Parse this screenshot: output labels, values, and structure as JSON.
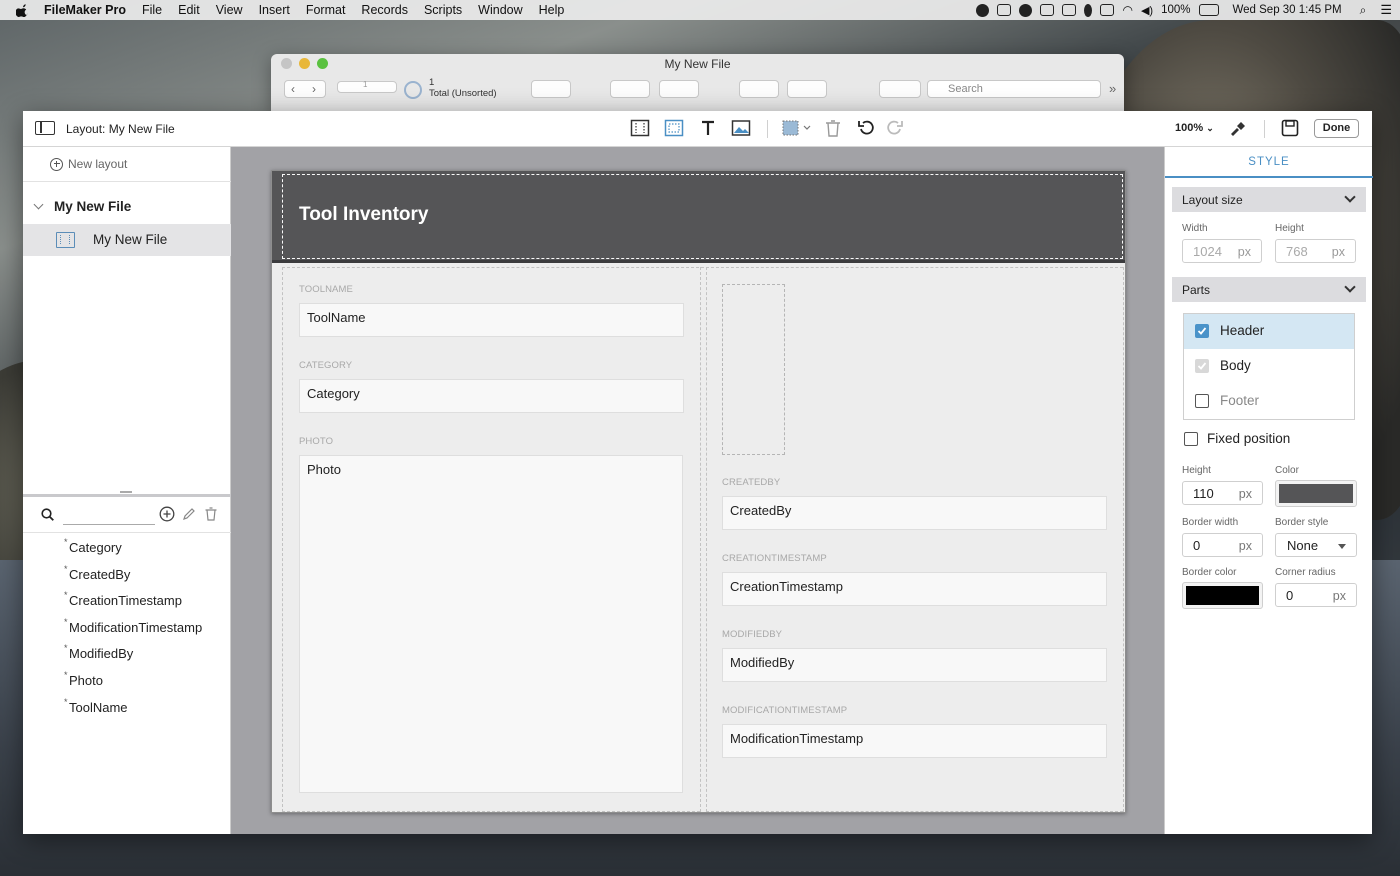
{
  "menubar": {
    "app_name": "FileMaker Pro",
    "menus": [
      "File",
      "Edit",
      "View",
      "Insert",
      "Format",
      "Records",
      "Scripts",
      "Window",
      "Help"
    ],
    "battery": "100%",
    "datetime": "Wed Sep 30  1:45 PM"
  },
  "browse_window": {
    "title": "My New File",
    "record_number": "1",
    "record_count": "1",
    "total_label": "Total (Unsorted)",
    "search_placeholder": "Search"
  },
  "layout_window": {
    "title": "Layout: My New File",
    "zoom": "100%",
    "done_label": "Done"
  },
  "left_panel": {
    "new_layout_label": "New layout",
    "folder_name": "My New File",
    "layout_name": "My New File",
    "fields": [
      "Category",
      "CreatedBy",
      "CreationTimestamp",
      "ModificationTimestamp",
      "ModifiedBy",
      "Photo",
      "ToolName"
    ]
  },
  "canvas": {
    "header_title": "Tool Inventory",
    "left_fields": [
      {
        "label": "TOOLNAME",
        "value": "ToolName"
      },
      {
        "label": "CATEGORY",
        "value": "Category"
      },
      {
        "label": "PHOTO",
        "value": "Photo"
      }
    ],
    "right_fields": [
      {
        "label": "CREATEDBY",
        "value": "CreatedBy"
      },
      {
        "label": "CREATIONTIMESTAMP",
        "value": "CreationTimestamp"
      },
      {
        "label": "MODIFIEDBY",
        "value": "ModifiedBy"
      },
      {
        "label": "MODIFICATIONTIMESTAMP",
        "value": "ModificationTimestamp"
      }
    ]
  },
  "inspector": {
    "tab_label": "STYLE",
    "layout_size": {
      "section_label": "Layout size",
      "width_label": "Width",
      "width_value": "1024",
      "height_label": "Height",
      "height_value": "768",
      "unit": "px"
    },
    "parts": {
      "section_label": "Parts",
      "items": [
        {
          "label": "Header",
          "checked": true,
          "selected": true
        },
        {
          "label": "Body",
          "checked": true,
          "disabled": true
        },
        {
          "label": "Footer",
          "checked": false
        }
      ],
      "fixed_position_label": "Fixed position"
    },
    "part_style": {
      "height_label": "Height",
      "height_value": "110",
      "color_label": "Color",
      "color_value": "#555557",
      "border_width_label": "Border width",
      "border_width_value": "0",
      "border_style_label": "Border style",
      "border_style_value": "None",
      "border_color_label": "Border color",
      "border_color_value": "#000000",
      "corner_radius_label": "Corner radius",
      "corner_radius_value": "0",
      "unit": "px"
    }
  },
  "colors": {
    "accent": "#4a8fc4",
    "header_fill": "#555557",
    "canvas_bg": "#a2a2a6"
  }
}
